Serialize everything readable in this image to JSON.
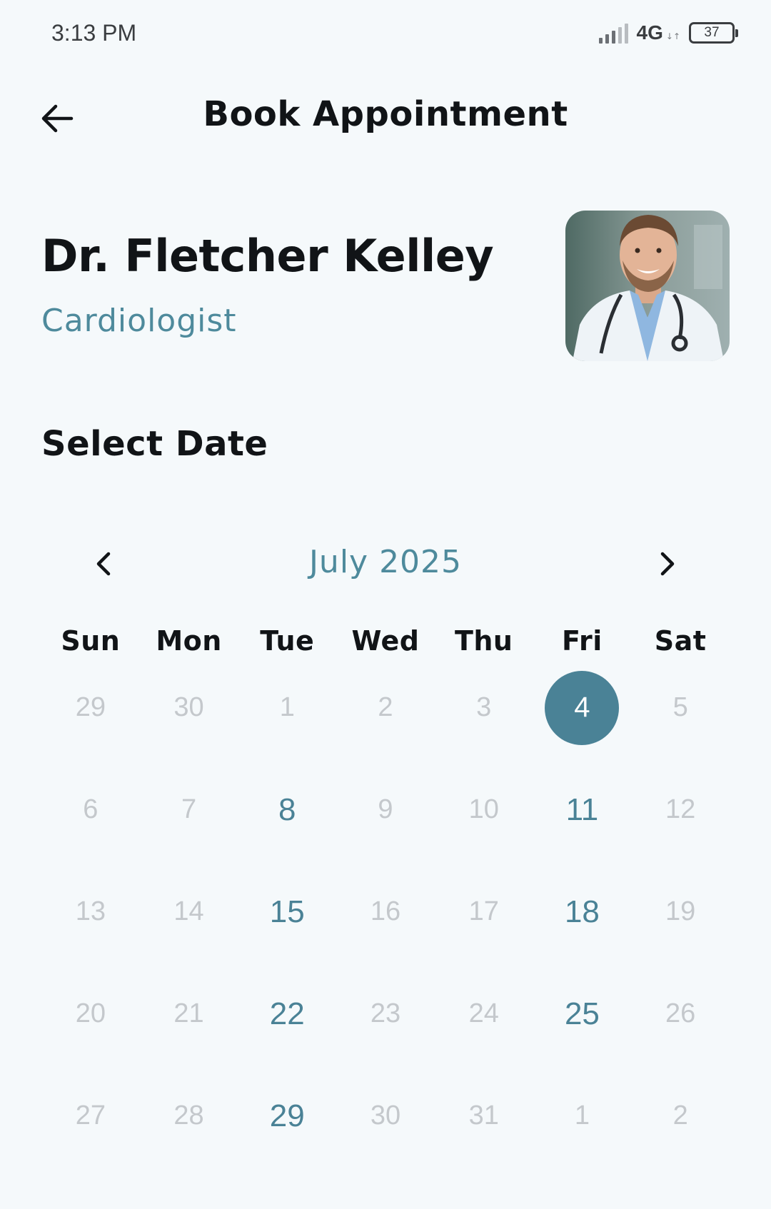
{
  "status_bar": {
    "time": "3:13 PM",
    "network": "4G",
    "battery": "37"
  },
  "header": {
    "title": "Book Appointment"
  },
  "doctor": {
    "name": "Dr. Fletcher Kelley",
    "specialty": "Cardiologist"
  },
  "date_section": {
    "title": "Select Date",
    "month_label": "July 2025",
    "weekdays": [
      "Sun",
      "Mon",
      "Tue",
      "Wed",
      "Thu",
      "Fri",
      "Sat"
    ],
    "days": [
      {
        "label": "29",
        "state": "disabled"
      },
      {
        "label": "30",
        "state": "disabled"
      },
      {
        "label": "1",
        "state": "disabled"
      },
      {
        "label": "2",
        "state": "disabled"
      },
      {
        "label": "3",
        "state": "disabled"
      },
      {
        "label": "4",
        "state": "selected"
      },
      {
        "label": "5",
        "state": "disabled"
      },
      {
        "label": "6",
        "state": "disabled"
      },
      {
        "label": "7",
        "state": "disabled"
      },
      {
        "label": "8",
        "state": "available"
      },
      {
        "label": "9",
        "state": "disabled"
      },
      {
        "label": "10",
        "state": "disabled"
      },
      {
        "label": "11",
        "state": "available"
      },
      {
        "label": "12",
        "state": "disabled"
      },
      {
        "label": "13",
        "state": "disabled"
      },
      {
        "label": "14",
        "state": "disabled"
      },
      {
        "label": "15",
        "state": "available"
      },
      {
        "label": "16",
        "state": "disabled"
      },
      {
        "label": "17",
        "state": "disabled"
      },
      {
        "label": "18",
        "state": "available"
      },
      {
        "label": "19",
        "state": "disabled"
      },
      {
        "label": "20",
        "state": "disabled"
      },
      {
        "label": "21",
        "state": "disabled"
      },
      {
        "label": "22",
        "state": "available"
      },
      {
        "label": "23",
        "state": "disabled"
      },
      {
        "label": "24",
        "state": "disabled"
      },
      {
        "label": "25",
        "state": "available"
      },
      {
        "label": "26",
        "state": "disabled"
      },
      {
        "label": "27",
        "state": "disabled"
      },
      {
        "label": "28",
        "state": "disabled"
      },
      {
        "label": "29",
        "state": "available"
      },
      {
        "label": "30",
        "state": "disabled"
      },
      {
        "label": "31",
        "state": "disabled"
      },
      {
        "label": "1",
        "state": "disabled"
      },
      {
        "label": "2",
        "state": "disabled"
      }
    ]
  },
  "icons": {
    "back": "arrow-left-icon",
    "prev_month": "chevron-left-icon",
    "next_month": "chevron-right-icon",
    "signal": "signal-icon",
    "battery": "battery-icon"
  },
  "colors": {
    "background": "#f5f9fb",
    "accent": "#4a8296",
    "text_primary": "#111417",
    "text_disabled": "#c4c8cc",
    "selected_text": "#ffffff"
  }
}
